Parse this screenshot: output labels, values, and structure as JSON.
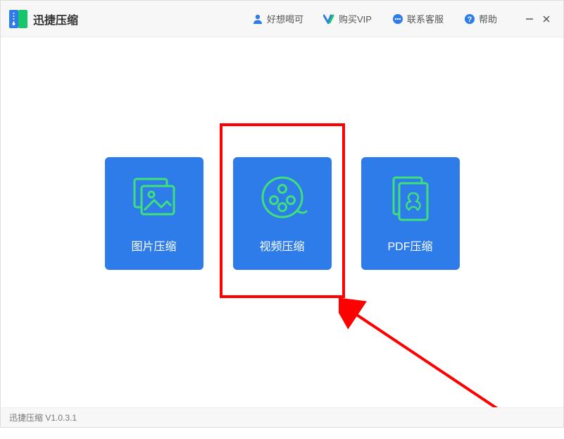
{
  "app": {
    "title": "迅捷压缩",
    "logo_colors": {
      "left": "#2d7cea",
      "right": "#15c66b"
    }
  },
  "nav": {
    "user": "好想喝可",
    "vip": "购买VIP",
    "support": "联系客服",
    "help": "帮助"
  },
  "cards": {
    "image": "图片压缩",
    "video": "视频压缩",
    "pdf": "PDF压缩"
  },
  "status": {
    "text": "迅捷压缩 V1.0.3.1"
  },
  "colors": {
    "card_bg": "#2d7cea",
    "accent_green": "#3fe07a",
    "highlight": "#ff0000"
  }
}
